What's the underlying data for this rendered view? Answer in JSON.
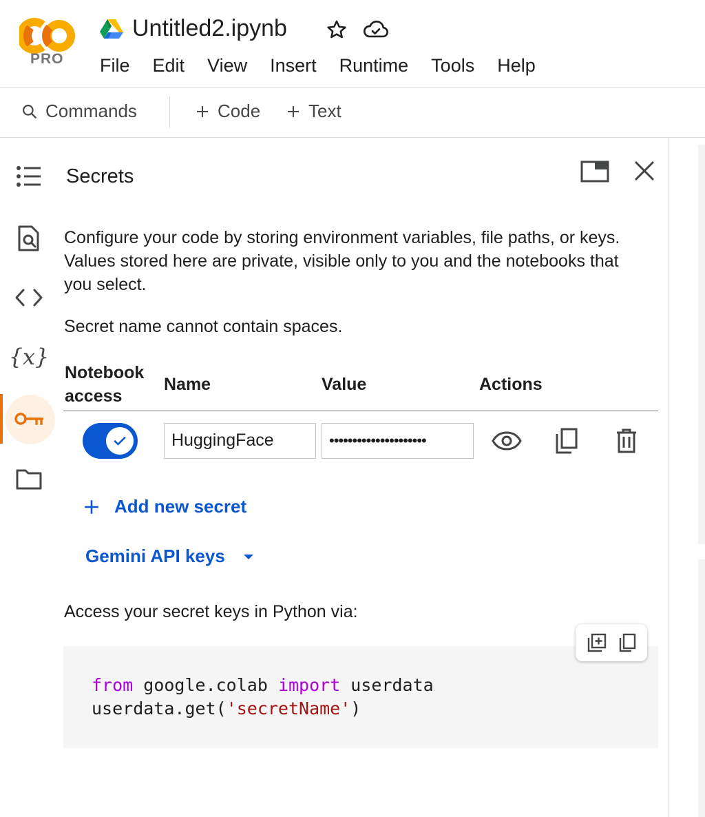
{
  "app": {
    "logo_text": "CO",
    "logo_badge": "PRO",
    "document_title": "Untitled2.ipynb"
  },
  "menu": [
    "File",
    "Edit",
    "View",
    "Insert",
    "Runtime",
    "Tools",
    "Help"
  ],
  "toolbar": {
    "commands_label": "Commands",
    "code_label": "Code",
    "text_label": "Text"
  },
  "sidebar": {
    "items": [
      {
        "icon": "toc-icon"
      },
      {
        "icon": "find-icon"
      },
      {
        "icon": "code-snippets-icon"
      },
      {
        "icon": "variables-icon"
      },
      {
        "icon": "key-icon",
        "active": true
      },
      {
        "icon": "folder-icon"
      }
    ]
  },
  "panel": {
    "title": "Secrets",
    "description": "Configure your code by storing environment variables, file paths, or keys. Values stored here are private, visible only to you and the notebooks that you select.",
    "note": "Secret name cannot contain spaces.",
    "columns": {
      "access_line1": "Notebook",
      "access_line2": "access",
      "name": "Name",
      "value": "Value",
      "actions": "Actions"
    },
    "secrets": [
      {
        "access": true,
        "name": "HuggingFace",
        "value_masked": "•••••••••••••••••••••"
      }
    ],
    "add_secret_label": "Add new secret",
    "gemini_label": "Gemini API keys",
    "access_label": "Access your secret keys in Python via:",
    "code": {
      "kw_from": "from",
      "module": " google.colab ",
      "kw_import": "import",
      "name": " userdata",
      "line2_prefix": "userdata.get(",
      "line2_string": "'secretName'",
      "line2_suffix": ")"
    }
  },
  "colors": {
    "accent_blue": "#0b57d0",
    "active_orange": "#e8710a",
    "keyword": "#af00db",
    "string": "#a31515"
  }
}
